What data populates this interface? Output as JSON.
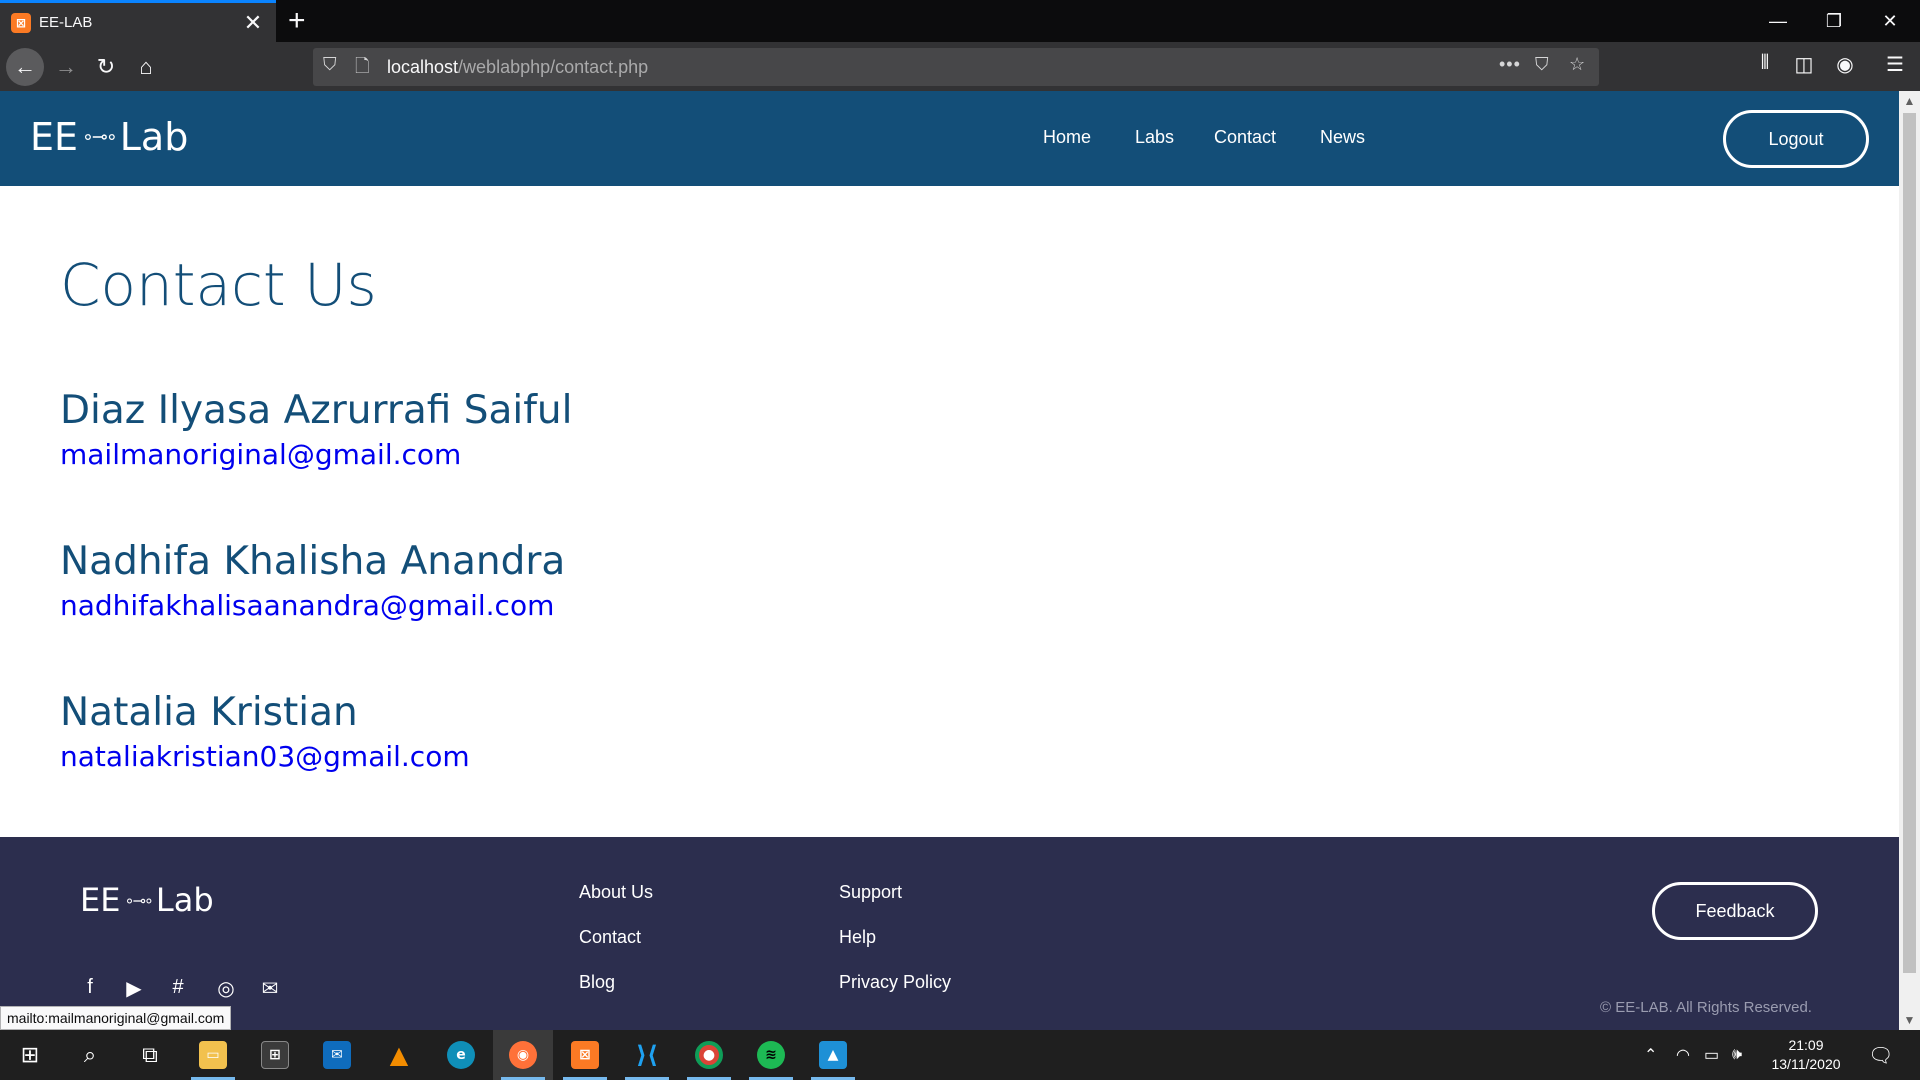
{
  "browser": {
    "tab_title": "EE-LAB",
    "tab_favicon": "xampp-icon",
    "url_host": "localhost",
    "url_path": "/weblabphp/contact.php",
    "status_link": "mailto:mailmanoriginal@gmail.com"
  },
  "site": {
    "logo_left": "EE",
    "logo_right": "Lab",
    "nav": [
      "Home",
      "Labs",
      "Contact",
      "News"
    ],
    "logout_label": "Logout"
  },
  "content": {
    "title": "Contact Us",
    "contacts": [
      {
        "name": "Diaz Ilyasa Azrurrafi Saiful",
        "email": "mailmanoriginal@gmail.com"
      },
      {
        "name": "Nadhifa Khalisha Anandra",
        "email": "nadhifakhalisaanandra@gmail.com"
      },
      {
        "name": "Natalia Kristian",
        "email": "nataliakristian03@gmail.com"
      }
    ]
  },
  "footer": {
    "logo_left": "EE",
    "logo_right": "Lab",
    "col1": [
      "About Us",
      "Contact",
      "Blog"
    ],
    "col2": [
      "Support",
      "Help",
      "Privacy Policy"
    ],
    "feedback_label": "Feedback",
    "copyright": "© EE-LAB. All Rights Reserved.",
    "social_icons": [
      "facebook-icon",
      "youtube-icon",
      "slack-icon",
      "instagram-icon",
      "mail-icon"
    ]
  },
  "taskbar": {
    "time": "21:09",
    "date": "13/11/2020"
  },
  "colors": {
    "header": "#134e78",
    "footer": "#2c2e4e",
    "link": "#0000ee"
  }
}
